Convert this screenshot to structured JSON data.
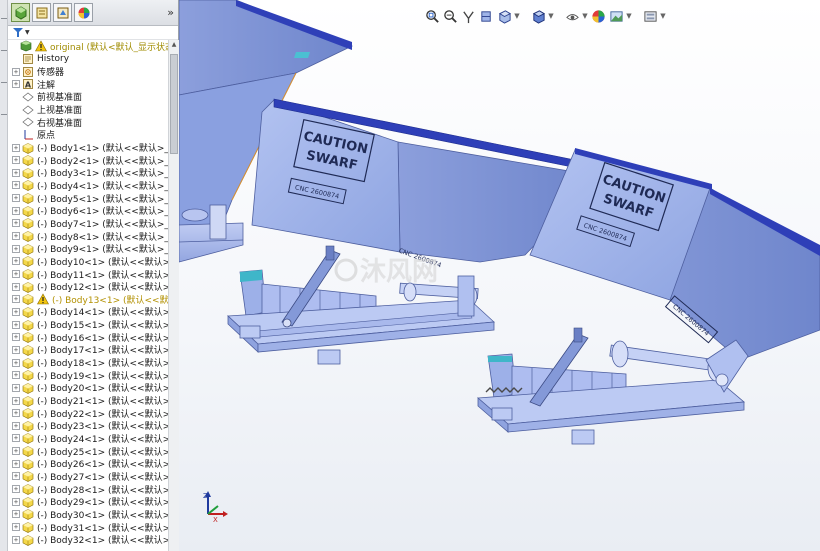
{
  "feature_tree": {
    "root": "original  (默认<默认_显示状态-1>",
    "items": [
      {
        "label": "History",
        "icon": "history-icon"
      },
      {
        "label": "传感器",
        "icon": "sensor-icon"
      },
      {
        "label": "注解",
        "icon": "annotation-icon"
      },
      {
        "label": "前视基准面",
        "icon": "plane-icon"
      },
      {
        "label": "上视基准面",
        "icon": "plane-icon"
      },
      {
        "label": "右视基准面",
        "icon": "plane-icon"
      },
      {
        "label": "原点",
        "icon": "origin-icon"
      }
    ],
    "bodies": [
      "(-) Body1<1> (默认<<默认>_显示",
      "(-) Body2<1> (默认<<默认>_显示",
      "(-) Body3<1> (默认<<默认>_显示",
      "(-) Body4<1> (默认<<默认>_显示",
      "(-) Body5<1> (默认<<默认>_显示",
      "(-) Body6<1> (默认<<默认>_显示",
      "(-) Body7<1> (默认<<默认>_显示",
      "(-) Body8<1> (默认<<默认>_显示",
      "(-) Body9<1> (默认<<默认>_显示",
      "(-) Body10<1> (默认<<默认>_显",
      "(-) Body11<1> (默认<<默认>_显",
      "(-) Body12<1> (默认<<默认>_显",
      "(-) Body13<1> (默认<<默认>",
      "(-) Body14<1> (默认<<默认>_显",
      "(-) Body15<1> (默认<<默认>_显",
      "(-) Body16<1> (默认<<默认>_显",
      "(-) Body17<1> (默认<<默认>_显",
      "(-) Body18<1> (默认<<默认>_显",
      "(-) Body19<1> (默认<<默认>_显",
      "(-) Body20<1> (默认<<默认>_显",
      "(-) Body21<1> (默认<<默认>_显",
      "(-) Body22<1> (默认<<默认>_显",
      "(-) Body23<1> (默认<<默认>_显",
      "(-) Body24<1> (默认<<默认>_显",
      "(-) Body25<1> (默认<<默认>_显",
      "(-) Body26<1> (默认<<默认>_显",
      "(-) Body27<1> (默认<<默认>_显",
      "(-) Body28<1> (默认<<默认>_显",
      "(-) Body29<1> (默认<<默认>_显",
      "(-) Body30<1> (默认<<默认>_显",
      "(-) Body31<1> (默认<<默认>_显",
      "(-) Body32<1> (默认<<默认>_显"
    ],
    "warning_body_index": 12
  },
  "model_labels": {
    "caution_line1": "CAUTION",
    "caution_line2": "SWARF",
    "plate_text": "CNC 2600874"
  },
  "triad": {
    "z": "Z",
    "x": "X",
    "y": "Y"
  },
  "watermark": "沐风网",
  "colors": {
    "bin_face": "#9aaee6",
    "bin_side": "#7f96d6",
    "bin_top_rim": "#2e3fb8",
    "frame": "#a9b8ea",
    "accent_cyan": "#3fb6c9",
    "warning_yellow": "#e5c700"
  }
}
